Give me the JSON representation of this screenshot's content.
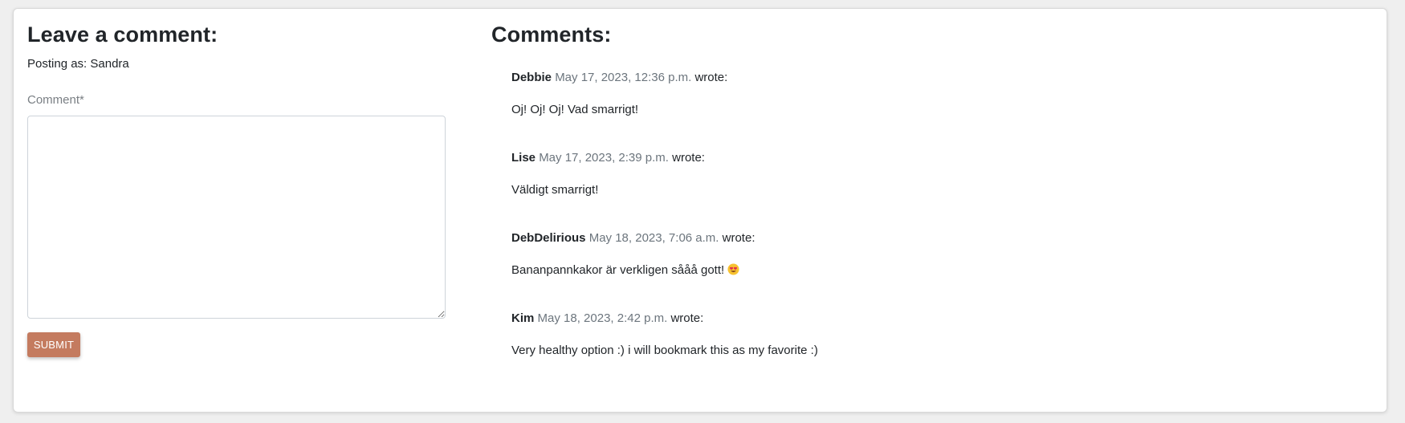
{
  "form": {
    "heading": "Leave a comment:",
    "posting_as": "Posting as: Sandra",
    "comment_label": "Comment*",
    "comment_value": "",
    "submit_label": "SUBMIT"
  },
  "comments_section": {
    "heading": "Comments:",
    "items": [
      {
        "author": "Debbie",
        "date": "May 17, 2023, 12:36 p.m.",
        "wrote": "wrote:",
        "body": "Oj! Oj! Oj! Vad smarrigt!"
      },
      {
        "author": "Lise",
        "date": "May 17, 2023, 2:39 p.m.",
        "wrote": "wrote:",
        "body": "Väldigt smarrigt!"
      },
      {
        "author": "DebDelirious",
        "date": "May 18, 2023, 7:06 a.m.",
        "wrote": "wrote:",
        "body": "Bananpannkakor är verkligen sååå gott!",
        "emoji": "smiling-face-with-heart-eyes-icon"
      },
      {
        "author": "Kim",
        "date": "May 18, 2023, 2:42 p.m.",
        "wrote": "wrote:",
        "body": "Very healthy option :) i will bookmark this as my favorite :)"
      }
    ]
  },
  "colors": {
    "accent": "#c47b5f",
    "muted_text": "#6c757d"
  }
}
